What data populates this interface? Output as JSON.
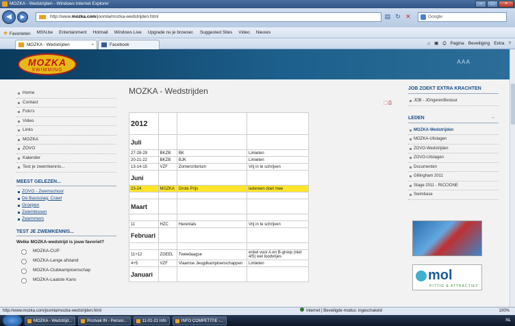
{
  "window": {
    "title": "MOZKA - Wedstrijden - Windows Internet Explorer"
  },
  "address": {
    "url_prefix": "http://www.",
    "url_domain": "mozka.com",
    "url_path": "/joomla/mozka-wedstrijden.html",
    "search_placeholder": "Google"
  },
  "favorites": {
    "label": "Favorieten",
    "items": [
      "MSN.be",
      "Entertainment",
      "Hotmail",
      "Windows Live",
      "Upgrade nu je browser.",
      "Suggested Sites",
      "Video",
      "Nieuws"
    ]
  },
  "tabs": [
    {
      "label": "MOZKA - Wedstrijden"
    },
    {
      "label": "Facebook"
    }
  ],
  "command_bar": {
    "page": "Pagina",
    "safety": "Beveiliging",
    "extra": "Extra"
  },
  "site": {
    "logo_main": "MOZKA",
    "logo_sub": "SWIMMING",
    "font_size_control": "A A A",
    "nav": [
      "Home",
      "Contact",
      "Foto's",
      "Video",
      "Links",
      "MOZKA",
      "ZOVO",
      "Kalender",
      "Test je zwemkennis..."
    ],
    "popular_title": "MEEST GELEZEN...",
    "popular": [
      "ZOVO - Zwemschool",
      "De Basisslag: Crawl",
      "Groepen",
      "Zwemlessen",
      "Zwemmers"
    ],
    "quiz_title": "TEST JE ZWEMKENNIS...",
    "quiz_question": "Welke MOZKA-wedstrijd is jouw favoriet?",
    "quiz_options": [
      "MOZKA-CUP",
      "MOZKA-Lange afstand",
      "MOZKA-Clubkampioenschap",
      "MOZKA-Laatste Kans"
    ]
  },
  "main": {
    "title": "MOZKA - Wedstrijden",
    "year": "2012",
    "months": [
      {
        "name": "Juli",
        "rows": [
          [
            "27-28-29",
            "BKZB",
            "BK",
            "Limieten"
          ],
          [
            "20-21-22",
            "BKZB",
            "BJK",
            "Limieten"
          ],
          [
            "13-14-15",
            "VZF",
            "Zomercriterium",
            "Vrij in te schrijven"
          ]
        ]
      },
      {
        "name": "Juni",
        "rows": [
          [
            "23-24",
            "MOZKA",
            "Grote Prijs",
            "Iedereen doet mee"
          ]
        ]
      },
      {
        "name": "Maart",
        "rows": [
          [
            "11",
            "HZC",
            "Herentals",
            "Vrij in te schrijven"
          ]
        ]
      },
      {
        "name": "Februari",
        "rows": [
          [
            "11+12",
            "ZGEEL",
            "Tweedaagse",
            "enkel voor A en B-groep (niet 4/5) wel loodvrijes"
          ],
          [
            "4+5",
            "VZF",
            "Vlaamse Jeugdkampioenschappen",
            "Limieten"
          ]
        ]
      },
      {
        "name": "Januari",
        "rows": []
      }
    ]
  },
  "right": {
    "jobs_title": "JOB ZOEKT EXTRA KRACHTEN",
    "jobs": [
      "JOB - JOngerenBestuur"
    ],
    "members_title": "LEDEN",
    "members": [
      "MOZKA-Wedstrijden",
      "MOZKA-Uitslagen",
      "ZOVO-Wedstrijden",
      "ZOVO-Uitslagen",
      "Documenten",
      "Gillingham 2011",
      "Stage 2011 - RICCIONE",
      "Swimbase"
    ],
    "mol_logo": "mol",
    "mol_tagline": "PITTIG & ATTRACTIEF"
  },
  "status": {
    "url": "http://www.mozka.com/joomla/mozka-wedstrijden.html",
    "zone": "Internet | Beveiligde modus: ingeschakeld",
    "zoom": "100%"
  },
  "taskbar": {
    "buttons": [
      "MOZKA - Wedstrijd...",
      "Postvak IN - Persoo...",
      "11-01-21 Info",
      "INFO COMPETITIE -..."
    ],
    "lang": "NL"
  }
}
